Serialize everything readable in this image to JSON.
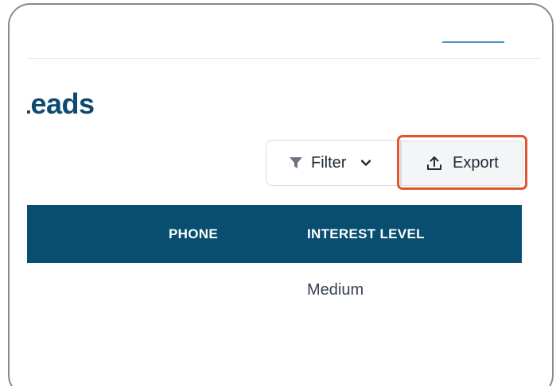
{
  "page": {
    "title": "Leads"
  },
  "toolbar": {
    "filter_label": "Filter",
    "export_label": "Export"
  },
  "table": {
    "columns": [
      "PHONE",
      "INTEREST LEVEL"
    ],
    "rows": [
      {
        "phone": "",
        "interest_level": "Medium"
      }
    ]
  },
  "icons": {
    "filter": "funnel-icon",
    "chevron": "chevron-down-icon",
    "export": "upload-icon"
  },
  "colors": {
    "title": "#0e4a70",
    "table_header_bg": "#084e70",
    "highlight_border": "#e0552a",
    "accent_line": "#4a95c6"
  }
}
